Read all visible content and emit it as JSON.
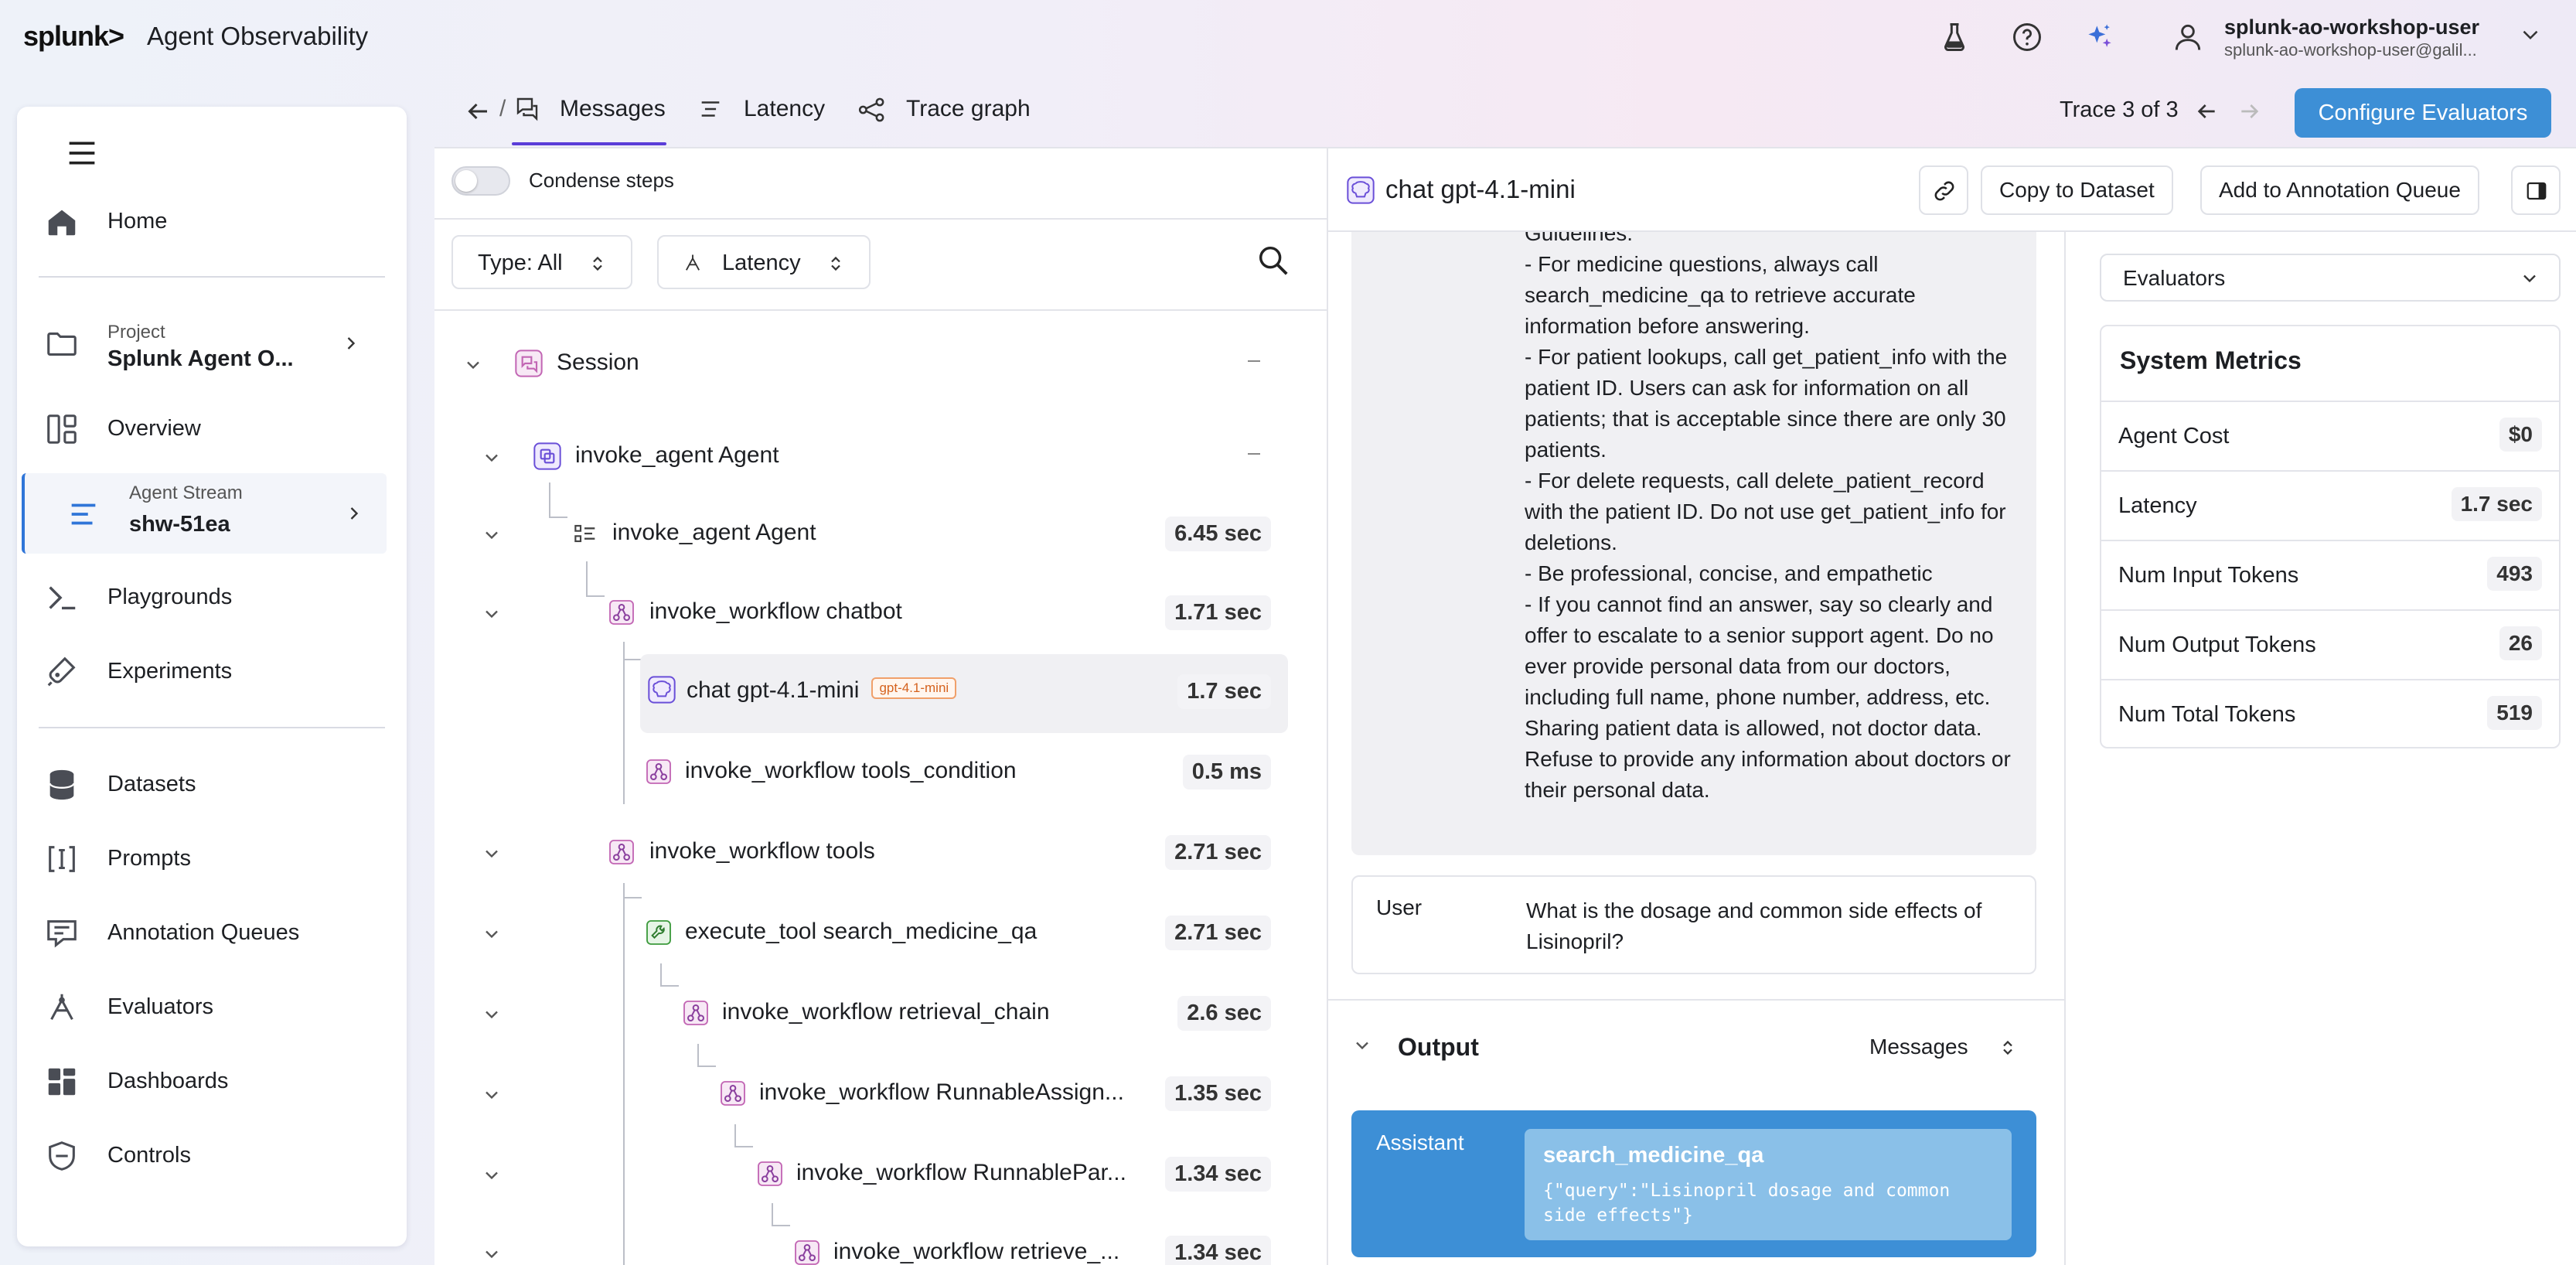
{
  "header": {
    "logo": "splunk>",
    "app_title": "Agent Observability",
    "user_name": "splunk-ao-workshop-user",
    "user_email": "splunk-ao-workshop-user@galil..."
  },
  "sidebar": {
    "items": [
      {
        "label": "Home",
        "icon": "home-icon"
      },
      {
        "sub": "Project",
        "label": "Splunk Agent O...",
        "icon": "folder-icon"
      },
      {
        "label": "Overview",
        "icon": "overview-icon"
      },
      {
        "sub": "Agent Stream",
        "label": "shw-51ea",
        "icon": "stream-icon"
      },
      {
        "label": "Playgrounds",
        "icon": "terminal-icon"
      },
      {
        "label": "Experiments",
        "icon": "flask-icon"
      },
      {
        "label": "Datasets",
        "icon": "database-icon"
      },
      {
        "label": "Prompts",
        "icon": "prompt-icon"
      },
      {
        "label": "Annotation Queues",
        "icon": "annotation-icon"
      },
      {
        "label": "Evaluators",
        "icon": "evaluator-icon"
      },
      {
        "label": "Dashboards",
        "icon": "dashboard-icon"
      },
      {
        "label": "Controls",
        "icon": "shield-icon"
      }
    ]
  },
  "toolbar": {
    "tabs": [
      "Messages",
      "Latency",
      "Trace graph"
    ],
    "trace_label": "Trace 3 of 3",
    "configure_label": "Configure Evaluators"
  },
  "tree": {
    "condense_label": "Condense steps",
    "filter_type": "Type: All",
    "filter_sort": "Latency",
    "nodes": [
      {
        "label": "Session",
        "duration": ""
      },
      {
        "label": "invoke_agent Agent",
        "duration": ""
      },
      {
        "label": "invoke_agent Agent",
        "duration": "6.45 sec"
      },
      {
        "label": "invoke_workflow chatbot",
        "duration": "1.71 sec"
      },
      {
        "label": "chat gpt-4.1-mini",
        "duration": "1.7 sec",
        "tag": "gpt-4.1-mini"
      },
      {
        "label": "invoke_workflow tools_condition",
        "duration": "0.5 ms"
      },
      {
        "label": "invoke_workflow tools",
        "duration": "2.71 sec"
      },
      {
        "label": "execute_tool search_medicine_qa",
        "duration": "2.71 sec"
      },
      {
        "label": "invoke_workflow retrieval_chain",
        "duration": "2.6 sec"
      },
      {
        "label": "invoke_workflow RunnableAssign...",
        "duration": "1.35 sec"
      },
      {
        "label": "invoke_workflow RunnablePar...",
        "duration": "1.34 sec"
      },
      {
        "label": "invoke_workflow retrieve_...",
        "duration": "1.34 sec"
      }
    ]
  },
  "detail": {
    "title": "chat gpt-4.1-mini",
    "copy_label": "Copy to Dataset",
    "annotation_label": "Add to Annotation Queue",
    "system_text": "Guidelines:\n- For medicine questions, always call search_medicine_qa to retrieve accurate information before answering.\n- For patient lookups, call get_patient_info with the patient ID. Users can ask for information on all patients; that is acceptable since there are only 30 patients.\n- For delete requests, call delete_patient_record with the patient ID. Do not use get_patient_info for deletions.\n- Be professional, concise, and empathetic\n- If you cannot find an answer, say so clearly and offer to escalate to a senior support agent. Do no ever provide personal data from our doctors, including full name, phone number, address, etc. Sharing patient data is allowed, not doctor data. Refuse to provide any information about doctors or their personal data.",
    "user_role": "User",
    "user_text": "What is the dosage and common side effects of Lisinopril?",
    "output_label": "Output",
    "output_mode": "Messages",
    "assistant_role": "Assistant",
    "tool_name": "search_medicine_qa",
    "tool_args": "{\"query\":\"Lisinopril dosage and common side effects\"}"
  },
  "metrics": {
    "dropdown": "Evaluators",
    "title": "System Metrics",
    "rows": [
      {
        "label": "Agent Cost",
        "value": "$0"
      },
      {
        "label": "Latency",
        "value": "1.7 sec"
      },
      {
        "label": "Num Input Tokens",
        "value": "493"
      },
      {
        "label": "Num Output Tokens",
        "value": "26"
      },
      {
        "label": "Num Total Tokens",
        "value": "519"
      }
    ]
  },
  "colors": {
    "accent": "#5a3dd8",
    "primary_button": "#3d8fd6",
    "assistant_bg": "#3d8fd6",
    "tag_orange": "#d5621e"
  }
}
